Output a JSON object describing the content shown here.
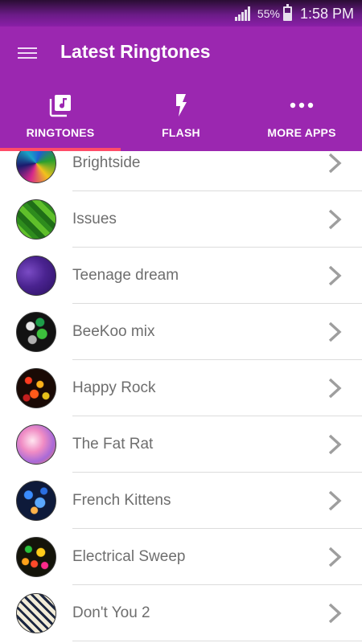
{
  "status_bar": {
    "battery_percent": "55%",
    "battery_level": 0.55,
    "time": "1:58 PM"
  },
  "app_bar": {
    "title": "Latest Ringtones",
    "menu_icon": "hamburger-menu-icon"
  },
  "tabs": [
    {
      "label": "RINGTONES",
      "icon": "music-library-icon",
      "selected": true
    },
    {
      "label": "FLASH",
      "icon": "flash-icon",
      "selected": false
    },
    {
      "label": "MORE APPS",
      "icon": "more-horizontal-icon",
      "selected": false
    }
  ],
  "ringtones": [
    {
      "name": "Brightside"
    },
    {
      "name": "Issues"
    },
    {
      "name": "Teenage dream"
    },
    {
      "name": "BeeKoo mix"
    },
    {
      "name": "Happy Rock"
    },
    {
      "name": "The Fat Rat"
    },
    {
      "name": "French Kittens"
    },
    {
      "name": "Electrical Sweep"
    },
    {
      "name": "Don't You 2"
    }
  ],
  "colors": {
    "status_bar": "#6a1b86",
    "app_bar": "#9b27b0",
    "tab_indicator": "#ff4c68",
    "list_text": "#6e6e6e",
    "chevron": "#9e9e9e",
    "divider": "#dcdcdc"
  }
}
